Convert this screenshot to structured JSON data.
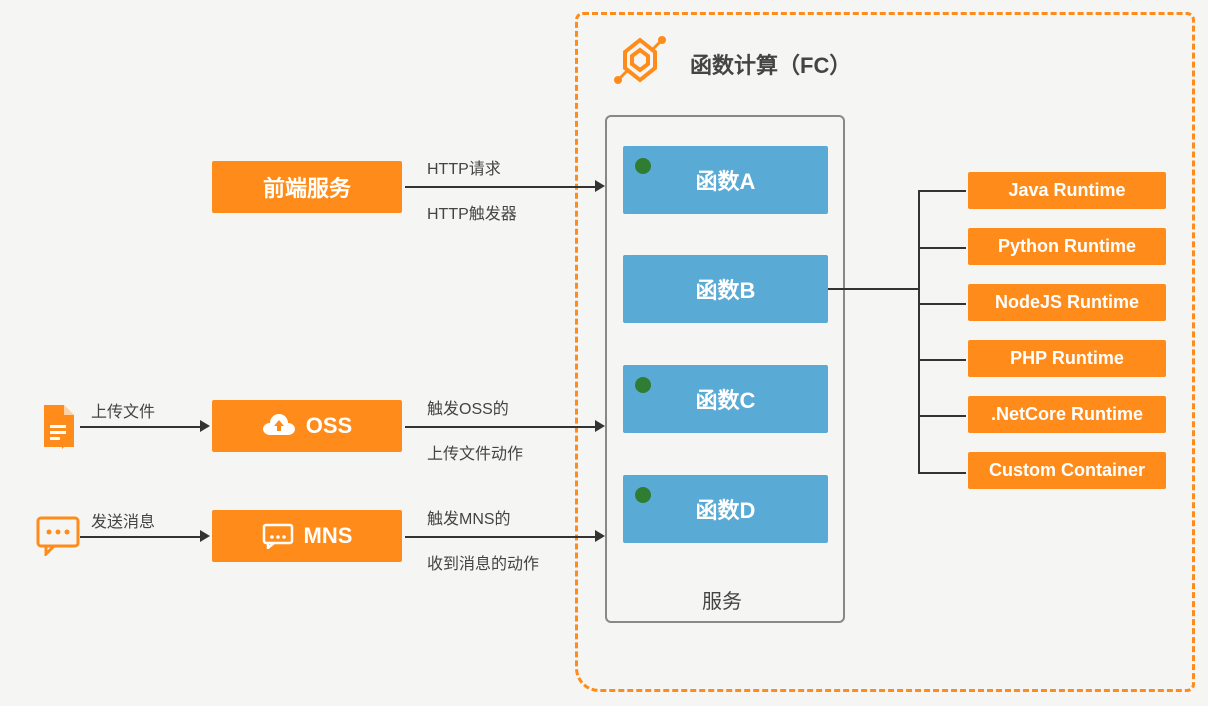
{
  "fc": {
    "title": "函数计算（FC）",
    "serviceLabel": "服务",
    "functions": [
      "函数A",
      "函数B",
      "函数C",
      "函数D"
    ]
  },
  "sources": {
    "frontend": "前端服务",
    "oss": "OSS",
    "mns": "MNS"
  },
  "labels": {
    "uploadFile": "上传文件",
    "sendMsg": "发送消息",
    "httpReq": "HTTP请求",
    "httpTrigger": "HTTP触发器",
    "ossTrigger1": "触发OSS的",
    "ossTrigger2": "上传文件动作",
    "mnsTrigger1": "触发MNS的",
    "mnsTrigger2": "收到消息的动作"
  },
  "runtimes": [
    "Java Runtime",
    "Python Runtime",
    "NodeJS Runtime",
    "PHP Runtime",
    ".NetCore Runtime",
    "Custom Container"
  ]
}
